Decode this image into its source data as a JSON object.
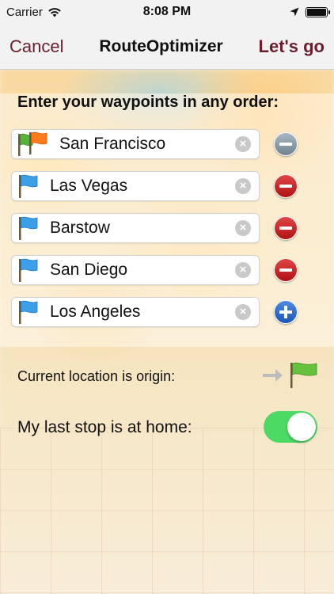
{
  "status_bar": {
    "carrier": "Carrier",
    "time": "8:08 PM",
    "wifi_icon": "wifi-icon",
    "location_icon": "location-arrow-icon",
    "battery_level": 1.0
  },
  "nav": {
    "cancel_label": "Cancel",
    "title": "RouteOptimizer",
    "go_label": "Let's go",
    "accent_color": "#6b1e2e"
  },
  "instructions": "Enter your waypoints in any order:",
  "waypoints": [
    {
      "name": "San Francisco",
      "flag": "green-orange-flags",
      "action": "remove-disabled"
    },
    {
      "name": "Las Vegas",
      "flag": "blue-flag",
      "action": "remove"
    },
    {
      "name": "Barstow",
      "flag": "blue-flag",
      "action": "remove"
    },
    {
      "name": "San Diego",
      "flag": "blue-flag",
      "action": "remove"
    },
    {
      "name": "Los Angeles",
      "flag": "blue-flag",
      "action": "add"
    }
  ],
  "origin": {
    "label": "Current location is origin:",
    "arrow_icon": "arrow-right-icon",
    "flag_icon": "green-flag-icon"
  },
  "home": {
    "label": "My last stop is at home:",
    "toggle_on": true,
    "toggle_color": "#4cd964"
  }
}
